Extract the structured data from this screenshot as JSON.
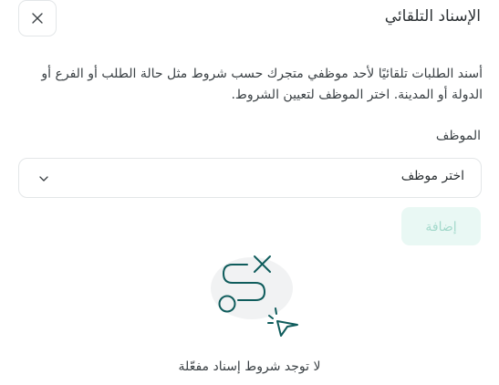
{
  "header": {
    "title": "الإسناد التلقائي",
    "close_icon": "close-icon"
  },
  "description": "أسند الطلبات تلقائيًا لأحد موظفي متجرك حسب شروط مثل حالة الطلب أو الفرع أو الدولة أو المدينة. اختر الموظف لتعيين الشروط.",
  "employee_field": {
    "label": "الموظف",
    "selected_value": "اختر موظف",
    "chevron_icon": "chevron-down-icon"
  },
  "add_button": {
    "label": "إضافة",
    "state": "disabled"
  },
  "empty_state": {
    "illustration_icon": "route-cursor-illustration",
    "text": "لا توجد شروط إسناد مفعّلة"
  },
  "colors": {
    "accent": "#0f5c5c",
    "button_disabled_bg": "#e9f8f4",
    "button_disabled_text": "#a3d9cb",
    "border": "#e3e6e8"
  }
}
